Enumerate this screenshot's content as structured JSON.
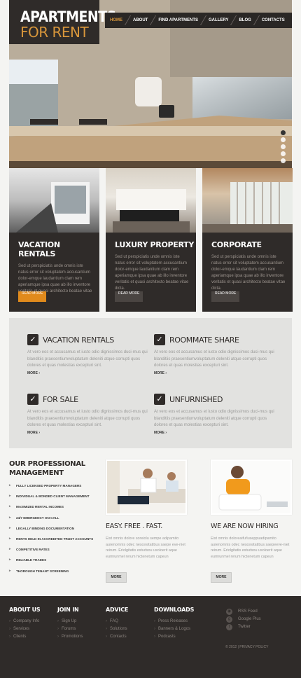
{
  "brand": {
    "line1": "APARTMENTS",
    "line2": "FOR RENT"
  },
  "nav": [
    "HOME",
    "ABOUT",
    "FIND APARTMENTS",
    "GALLERY",
    "BLOG",
    "CONTACTS"
  ],
  "slider": {
    "dot_count": 5,
    "active_index": 0
  },
  "features": [
    {
      "title": "Vacation Rentals",
      "text": "Sed ut perspiciatis unde omnis iste natus error sit voluptatem accusantium dolor-emque laudantium clam rem aperiamque ipsa quae ab illo inventore veritatis et quasi architecto beatae vitae dicta.",
      "button": "READ MORE",
      "button_style": "orange"
    },
    {
      "title": "Luxury Property",
      "text": "Sed ut perspiciatis unde omnis iste natus error sit voluptatem accusantium dolor-emque laudantium clam rem aperiamque ipsa quae ab illo inventore veritatis et quasi architecto beatae vitae dicta.",
      "button": "READ MORE",
      "button_style": "dark"
    },
    {
      "title": "Corporate",
      "text": "Sed ut perspiciatis unde omnis iste natus error sit voluptatem accusantium dolor-emque laudantium clam rem aperiamque ipsa quae ab illo inventore veritatis et quasi architecto beatae vitae dicta.",
      "button": "READ MORE",
      "button_style": "dark"
    }
  ],
  "services": [
    {
      "title": "Vacation Rentals",
      "text": "At vero eos et accusamus et iusto odio dignissimos duci-mus qui blanditiis praesentiumvoluptatum deleniti atque corrupti quos dolores et quas molestias excepturi sint.",
      "more": "MORE"
    },
    {
      "title": "Roommate Share",
      "text": "At vero eos et accusamus et iusto odio dignissimos duci-mus qui blanditiis praesentiumvoluptatum deleniti atque corrupti quos dolores et quas molestias excepturi sint.",
      "more": "MORE"
    },
    {
      "title": "For Sale",
      "text": "At vero eos et accusamus et iusto odio dignissimos duci-mus qui blanditiis praesentiumvoluptatum deleniti atque corrupti quos dolores et quas molestias excepturi sint.",
      "more": "MORE"
    },
    {
      "title": "Unfurnished",
      "text": "At vero eos et accusamus et iusto odio dignissimos duci-mus qui blanditiis praesentiumvoluptatum deleniti atque corrupti quos dolores et quas molestias excepturi sint.",
      "more": "MORE"
    }
  ],
  "management": {
    "title_line1": "Our Professional",
    "title_line2": "Management",
    "items": [
      "FULLY LICENSED PROPERTY MANAGERS",
      "INDIVIDUAL & BONDED CLIENT MANAGEMENT",
      "MAXIMIZED RENTAL INCOMES",
      "24/7 EMERGENCY ON CALL",
      "LEGALLY BINDING DOCUMENTATION",
      "RENTS HELD IN ACCREDITED TRUST ACCOUNTS",
      "COMPETITIVE RATES",
      "RELIABLE TRADES",
      "THOROUGH TENANT SCREENING"
    ]
  },
  "promo": [
    {
      "title": "Easy. Free . Fast.",
      "text": "Eist omnis dolore soreiolu sempe adipamito aurenomnis odec nescesitatibus saepe eve-niet reirum. Eriolgitatis estudsou usoloerit aque eumrunmel rerum hictenetum capeun",
      "button": "MORE"
    },
    {
      "title": "We Are Now Hiring",
      "text": "Eist omnis doloreaifufiuseppuadipamito aurenomnis odec nescesitatibus saepeeve-niet reirum. Eriolgitatis estudsou usoloerit aque eumrunmel rerum hictenetum capeun",
      "button": "MORE"
    }
  ],
  "footer": {
    "columns": [
      {
        "title": "About Us",
        "links": [
          "Company Info",
          "Services",
          "Clients"
        ]
      },
      {
        "title": "Join In",
        "links": [
          "Sign Up",
          "Forums",
          "Promotions"
        ]
      },
      {
        "title": "Advice",
        "links": [
          "FAQ",
          "Solutions",
          "Contacts"
        ]
      },
      {
        "title": "Downloads",
        "links": [
          "Press Releases",
          "Banners & Logos",
          "Podcasts"
        ]
      }
    ],
    "social": [
      {
        "label": "RSS Feed",
        "icon": "rss-icon"
      },
      {
        "label": "Google Plus",
        "icon": "google-plus-icon"
      },
      {
        "label": "Twitter",
        "icon": "twitter-icon"
      }
    ],
    "copyright": "© 2012 | PRIVACY POLICY"
  },
  "colors": {
    "accent": "#d8963b",
    "dark": "#2f2b29",
    "button_orange": "#e08a1c",
    "band": "#e2e2e0"
  }
}
